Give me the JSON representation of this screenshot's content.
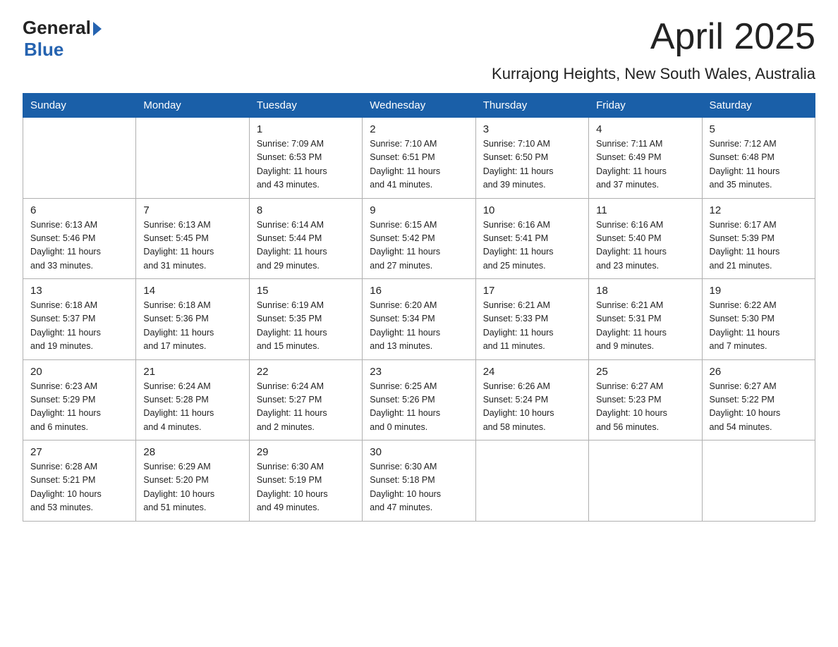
{
  "header": {
    "logo_general": "General",
    "logo_blue": "Blue",
    "month_title": "April 2025",
    "subtitle": "Kurrajong Heights, New South Wales, Australia"
  },
  "days_of_week": [
    "Sunday",
    "Monday",
    "Tuesday",
    "Wednesday",
    "Thursday",
    "Friday",
    "Saturday"
  ],
  "weeks": [
    [
      {
        "day": "",
        "info": ""
      },
      {
        "day": "",
        "info": ""
      },
      {
        "day": "1",
        "info": "Sunrise: 7:09 AM\nSunset: 6:53 PM\nDaylight: 11 hours\nand 43 minutes."
      },
      {
        "day": "2",
        "info": "Sunrise: 7:10 AM\nSunset: 6:51 PM\nDaylight: 11 hours\nand 41 minutes."
      },
      {
        "day": "3",
        "info": "Sunrise: 7:10 AM\nSunset: 6:50 PM\nDaylight: 11 hours\nand 39 minutes."
      },
      {
        "day": "4",
        "info": "Sunrise: 7:11 AM\nSunset: 6:49 PM\nDaylight: 11 hours\nand 37 minutes."
      },
      {
        "day": "5",
        "info": "Sunrise: 7:12 AM\nSunset: 6:48 PM\nDaylight: 11 hours\nand 35 minutes."
      }
    ],
    [
      {
        "day": "6",
        "info": "Sunrise: 6:13 AM\nSunset: 5:46 PM\nDaylight: 11 hours\nand 33 minutes."
      },
      {
        "day": "7",
        "info": "Sunrise: 6:13 AM\nSunset: 5:45 PM\nDaylight: 11 hours\nand 31 minutes."
      },
      {
        "day": "8",
        "info": "Sunrise: 6:14 AM\nSunset: 5:44 PM\nDaylight: 11 hours\nand 29 minutes."
      },
      {
        "day": "9",
        "info": "Sunrise: 6:15 AM\nSunset: 5:42 PM\nDaylight: 11 hours\nand 27 minutes."
      },
      {
        "day": "10",
        "info": "Sunrise: 6:16 AM\nSunset: 5:41 PM\nDaylight: 11 hours\nand 25 minutes."
      },
      {
        "day": "11",
        "info": "Sunrise: 6:16 AM\nSunset: 5:40 PM\nDaylight: 11 hours\nand 23 minutes."
      },
      {
        "day": "12",
        "info": "Sunrise: 6:17 AM\nSunset: 5:39 PM\nDaylight: 11 hours\nand 21 minutes."
      }
    ],
    [
      {
        "day": "13",
        "info": "Sunrise: 6:18 AM\nSunset: 5:37 PM\nDaylight: 11 hours\nand 19 minutes."
      },
      {
        "day": "14",
        "info": "Sunrise: 6:18 AM\nSunset: 5:36 PM\nDaylight: 11 hours\nand 17 minutes."
      },
      {
        "day": "15",
        "info": "Sunrise: 6:19 AM\nSunset: 5:35 PM\nDaylight: 11 hours\nand 15 minutes."
      },
      {
        "day": "16",
        "info": "Sunrise: 6:20 AM\nSunset: 5:34 PM\nDaylight: 11 hours\nand 13 minutes."
      },
      {
        "day": "17",
        "info": "Sunrise: 6:21 AM\nSunset: 5:33 PM\nDaylight: 11 hours\nand 11 minutes."
      },
      {
        "day": "18",
        "info": "Sunrise: 6:21 AM\nSunset: 5:31 PM\nDaylight: 11 hours\nand 9 minutes."
      },
      {
        "day": "19",
        "info": "Sunrise: 6:22 AM\nSunset: 5:30 PM\nDaylight: 11 hours\nand 7 minutes."
      }
    ],
    [
      {
        "day": "20",
        "info": "Sunrise: 6:23 AM\nSunset: 5:29 PM\nDaylight: 11 hours\nand 6 minutes."
      },
      {
        "day": "21",
        "info": "Sunrise: 6:24 AM\nSunset: 5:28 PM\nDaylight: 11 hours\nand 4 minutes."
      },
      {
        "day": "22",
        "info": "Sunrise: 6:24 AM\nSunset: 5:27 PM\nDaylight: 11 hours\nand 2 minutes."
      },
      {
        "day": "23",
        "info": "Sunrise: 6:25 AM\nSunset: 5:26 PM\nDaylight: 11 hours\nand 0 minutes."
      },
      {
        "day": "24",
        "info": "Sunrise: 6:26 AM\nSunset: 5:24 PM\nDaylight: 10 hours\nand 58 minutes."
      },
      {
        "day": "25",
        "info": "Sunrise: 6:27 AM\nSunset: 5:23 PM\nDaylight: 10 hours\nand 56 minutes."
      },
      {
        "day": "26",
        "info": "Sunrise: 6:27 AM\nSunset: 5:22 PM\nDaylight: 10 hours\nand 54 minutes."
      }
    ],
    [
      {
        "day": "27",
        "info": "Sunrise: 6:28 AM\nSunset: 5:21 PM\nDaylight: 10 hours\nand 53 minutes."
      },
      {
        "day": "28",
        "info": "Sunrise: 6:29 AM\nSunset: 5:20 PM\nDaylight: 10 hours\nand 51 minutes."
      },
      {
        "day": "29",
        "info": "Sunrise: 6:30 AM\nSunset: 5:19 PM\nDaylight: 10 hours\nand 49 minutes."
      },
      {
        "day": "30",
        "info": "Sunrise: 6:30 AM\nSunset: 5:18 PM\nDaylight: 10 hours\nand 47 minutes."
      },
      {
        "day": "",
        "info": ""
      },
      {
        "day": "",
        "info": ""
      },
      {
        "day": "",
        "info": ""
      }
    ]
  ]
}
